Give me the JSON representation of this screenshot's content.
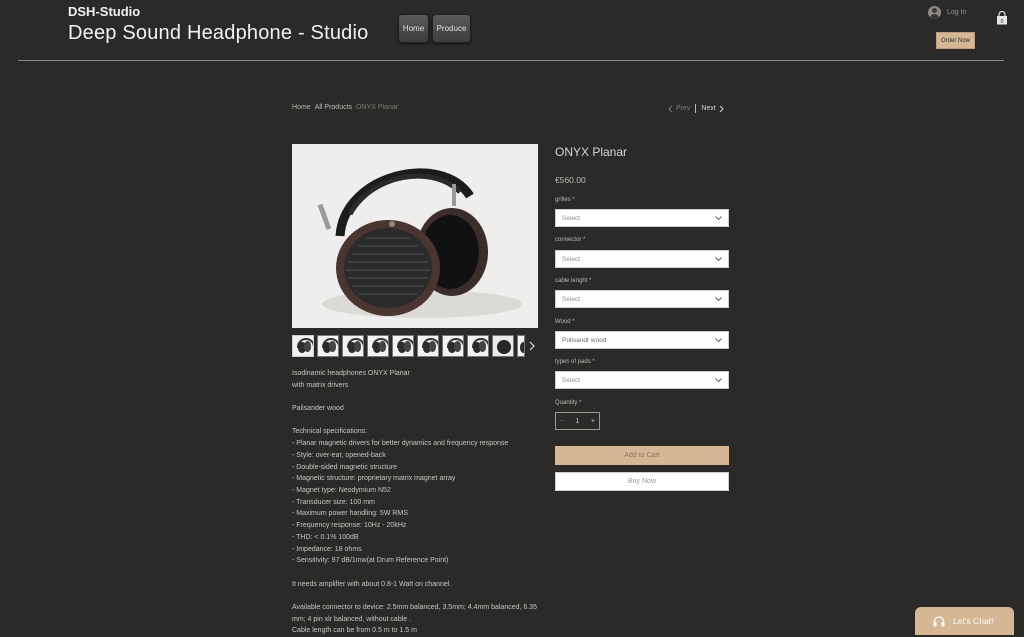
{
  "header": {
    "brand": "DSH-Studio",
    "title": "Deep Sound Headphone - Studio",
    "nav": [
      {
        "label": "Home"
      },
      {
        "label": "Produce"
      }
    ],
    "login_label": "Log In",
    "order_now_label": "Order Now",
    "icons": {
      "avatar": "user-avatar-icon",
      "cart": "shopping-bag-icon"
    }
  },
  "breadcrumb": {
    "home": "Home",
    "all_products": "All Products",
    "current": "ONYX Planar"
  },
  "pager": {
    "prev": "Prev",
    "next": "Next"
  },
  "product": {
    "name": "ONYX Planar",
    "price": "€560.00",
    "options": [
      {
        "label": "grilles *",
        "value": "Select"
      },
      {
        "label": "connector *",
        "value": "Select"
      },
      {
        "label": "cable lenght *",
        "value": "Select"
      },
      {
        "label": "Wood *",
        "value": "Polisandr wood"
      },
      {
        "label": "types of pads *",
        "value": "Select"
      }
    ],
    "quantity_label": "Quantity *",
    "quantity": "1",
    "qty_minus": "−",
    "qty_plus": "+",
    "add_to_cart": "Add to Cart",
    "buy_now": "Buy Now",
    "thumbnail_count": 10
  },
  "description": {
    "lines": [
      "Isodinamic headphones ONYX Planar",
      "with matrix drivers",
      "",
      "Palisander wood",
      "",
      "Technical specifications:",
      "- Planar magnetic drivers for better dynamics and frequency response",
      "- Style: over-ear, opened-back",
      "- Double-sided magnetic structure",
      "- Magnetic structure: proprietary matrix magnet array",
      "- Magnet type: Neodymium N52",
      "- Transducer size: 100 mm",
      "- Maximum power handling: 5W RMS",
      "- Frequency response: 10Hz - 20kHz",
      "- THD: < 0.1% 100dB",
      "- Impedance: 18 ohms",
      "- Sensitivity: 97 dB/1mw(at Drum Reference Point)",
      "",
      "It needs amplifier with about 0.8-1 Watt on channel.",
      "",
      "Available connector to device: 2.5mm balanced, 3.5mm; 4.4mm balanced, 6.35",
      "mm; 4 pin xlr balanced, without cable .",
      "Cable length can be from 0.5 m to 1.5 m"
    ]
  },
  "chat": {
    "label": "Let's Chat!",
    "icon": "headset-icon"
  },
  "colors": {
    "background": "#2b2a29",
    "accent": "#d5b796",
    "text": "#e8e6e3"
  }
}
